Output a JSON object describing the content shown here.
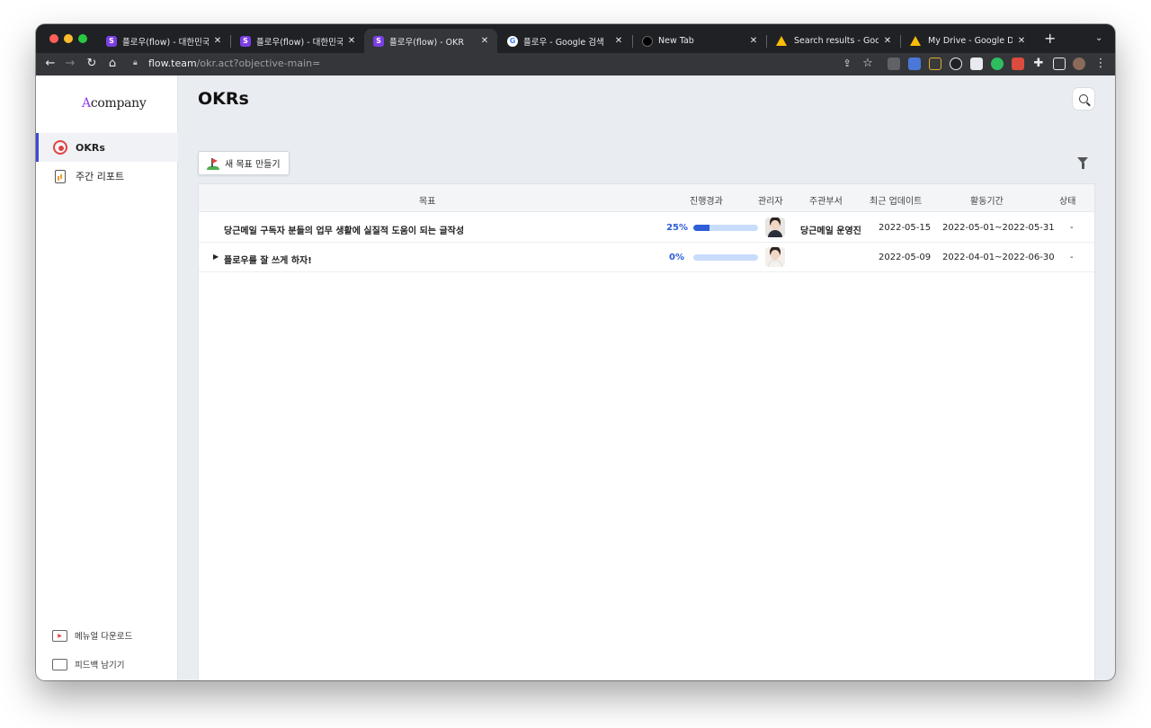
{
  "browser": {
    "tabs": [
      {
        "title": "플로우(flow) - 대한민국 No.",
        "favicon": "flow-icon",
        "active": false
      },
      {
        "title": "플로우(flow) - 대한민국 NO.",
        "favicon": "flow-icon",
        "active": false
      },
      {
        "title": "플로우(flow) - OKR",
        "favicon": "flow-icon",
        "active": true
      },
      {
        "title": "플로우 - Google 검색",
        "favicon": "google-icon",
        "active": false
      },
      {
        "title": "New Tab",
        "favicon": "newtab-icon",
        "active": false
      },
      {
        "title": "Search results - Google D",
        "favicon": "drive-icon",
        "active": false
      },
      {
        "title": "My Drive - Google Drive",
        "favicon": "drive-icon",
        "active": false
      }
    ],
    "close_glyph": "✕",
    "new_tab_glyph": "+",
    "url_host": "flow.team",
    "url_path": "/okr.act?objective-main="
  },
  "sidebar": {
    "logo": "Acompany",
    "logo_accent": "A",
    "logo_rest": "company",
    "items": [
      {
        "label": "OKRs",
        "icon": "target-icon",
        "active": true
      },
      {
        "label": "주간 리포트",
        "icon": "report-icon",
        "active": false
      }
    ],
    "bottom": [
      {
        "label": "메뉴얼 다운로드",
        "icon": "video-icon"
      },
      {
        "label": "피드백 남기기",
        "icon": "book-icon"
      }
    ]
  },
  "main": {
    "title": "OKRs",
    "create_button": "새 목표 만들기",
    "columns": {
      "goal": "목표",
      "progress": "진행경과",
      "manager": "관리자",
      "department": "주관부서",
      "updated": "최근 업데이트",
      "period": "활동기간",
      "status": "상태"
    },
    "rows": [
      {
        "goal": "당근메일 구독자 분들의 업무 생활에 실질적 도움이 되는 글작성",
        "progress_text": "25%",
        "progress": 0.25,
        "department": "당근메일 운영진",
        "updated": "2022-05-15",
        "period": "2022-05-01~2022-05-31",
        "status": "-",
        "expandable": false
      },
      {
        "goal": "플로우를 잘 쓰게 하자!",
        "progress_text": "0%",
        "progress": 0,
        "department": "",
        "updated": "2022-05-09",
        "period": "2022-04-01~2022-06-30",
        "status": "-",
        "expandable": true
      }
    ],
    "expander_glyph": "▶"
  },
  "colors": {
    "accent": "#2f5ed8",
    "brand_purple": "#8a3ff0",
    "progress_track": "#c9dcfb"
  }
}
